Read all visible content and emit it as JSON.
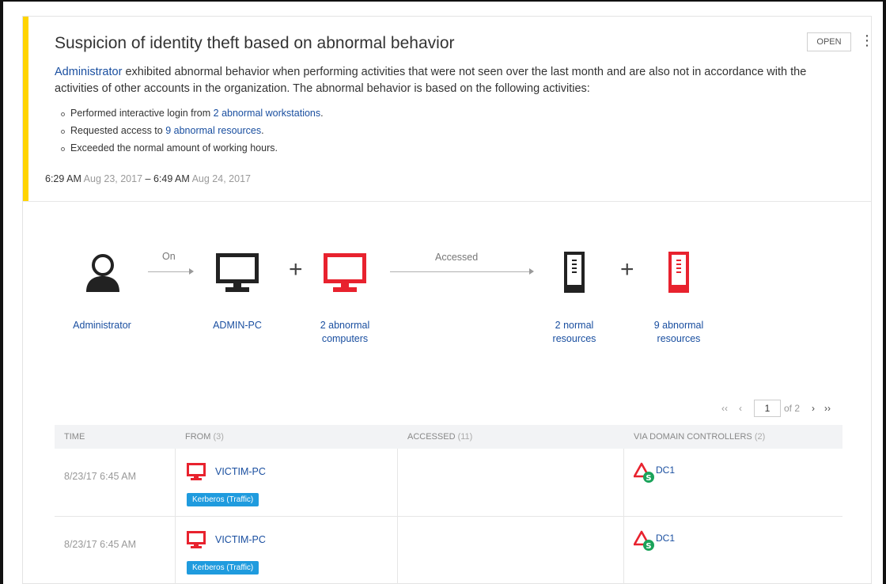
{
  "alert": {
    "title": "Suspicion of identity theft based on abnormal behavior",
    "status": "OPEN",
    "more_glyph": "⋮",
    "accent_color": "#ffd400",
    "desc_user": "Administrator",
    "desc_text": " exhibited abnormal behavior when performing activities that were not seen over the last month and are also not in accordance with the activities of other accounts in the organization. The abnormal behavior is based on the following activities:",
    "bullets": [
      {
        "prefix": "Performed interactive login from ",
        "link": "2 abnormal workstations",
        "suffix": "."
      },
      {
        "prefix": "Requested access to ",
        "link": "9 abnormal resources",
        "suffix": "."
      },
      {
        "prefix": "Exceeded the normal amount of working hours.",
        "link": "",
        "suffix": ""
      }
    ],
    "time_start": "6:29 AM",
    "date_start": " Aug 23, 2017",
    "time_sep": " – ",
    "time_end": "6:49 AM",
    "date_end": " Aug 24, 2017"
  },
  "diagram": {
    "user_label": "Administrator",
    "on_label": "On",
    "pc_label": "ADMIN-PC",
    "abnormal_computers_1": "2 abnormal",
    "abnormal_computers_2": "computers",
    "accessed_label": "Accessed",
    "normal_res_1": "2 normal",
    "normal_res_2": "resources",
    "abnormal_res_1": "9 abnormal",
    "abnormal_res_2": "resources",
    "plus": "+",
    "normal_color": "#222222",
    "abnormal_color": "#e8222e"
  },
  "pager": {
    "first": "‹‹",
    "prev": "‹",
    "page": "1",
    "of": "of 2",
    "next": "›",
    "last": "››"
  },
  "table": {
    "headers": [
      {
        "label": "TIME",
        "count": ""
      },
      {
        "label": "FROM",
        "count": " (3)"
      },
      {
        "label": "ACCESSED",
        "count": " (11)"
      },
      {
        "label": "VIA DOMAIN CONTROLLERS",
        "count": " (2)"
      }
    ],
    "rows": [
      {
        "time": "8/23/17 6:45 AM",
        "from": "VICTIM-PC",
        "protocol": "Kerberos (Traffic)",
        "dc": "DC1"
      },
      {
        "time": "8/23/17 6:45 AM",
        "from": "VICTIM-PC",
        "protocol": "Kerberos (Traffic)",
        "dc": "DC1"
      }
    ]
  }
}
